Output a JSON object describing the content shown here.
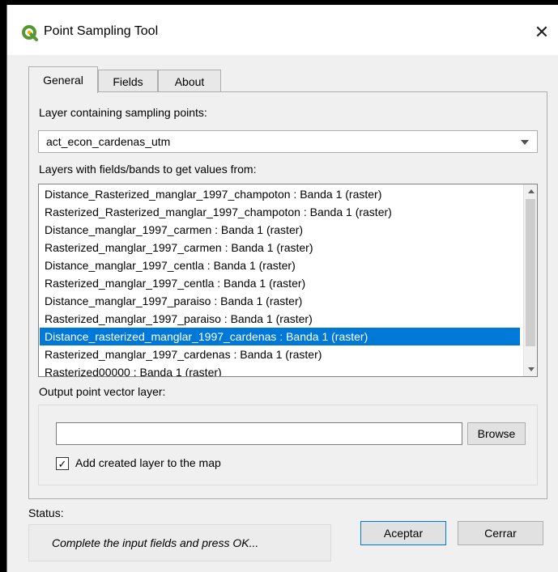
{
  "window": {
    "title": "Point Sampling Tool",
    "close_glyph": "✕",
    "app_icon": "qgis-logo-icon"
  },
  "tabs": [
    {
      "label": "General",
      "active": true
    },
    {
      "label": "Fields",
      "active": false
    },
    {
      "label": "About",
      "active": false
    }
  ],
  "general": {
    "sampling_label": "Layer containing sampling points:",
    "sampling_value": "act_econ_cardenas_utm",
    "layers_label": "Layers with fields/bands to get values from:",
    "layers": [
      "Distance_Rasterized_manglar_1997_champoton : Banda 1 (raster)",
      "Rasterized_Rasterized_manglar_1997_champoton : Banda 1 (raster)",
      "Distance_manglar_1997_carmen : Banda 1 (raster)",
      "Rasterized_manglar_1997_carmen : Banda 1 (raster)",
      "Distance_manglar_1997_centla : Banda 1 (raster)",
      "Rasterized_manglar_1997_centla : Banda 1 (raster)",
      "Distance_manglar_1997_paraiso : Banda 1 (raster)",
      "Rasterized_manglar_1997_paraiso : Banda 1 (raster)",
      "Distance_rasterized_manglar_1997_cardenas : Banda 1 (raster)",
      "Rasterized_manglar_1997_cardenas : Banda 1 (raster)",
      "Rasterized00000 : Banda 1 (raster)"
    ],
    "selected_index": 8,
    "output_label": "Output point vector layer:",
    "output_value": "",
    "browse_label": "Browse",
    "add_layer_label": "Add created layer to the map",
    "add_layer_checked": true,
    "check_glyph": "✓"
  },
  "footer": {
    "status_label": "Status:",
    "status_text": "Complete the input fields and press OK...",
    "accept_label": "Aceptar",
    "close_label": "Cerrar"
  },
  "colors": {
    "selection": "#0078d7",
    "qgis_green": "#589632",
    "qgis_yellow": "#ee7913"
  }
}
